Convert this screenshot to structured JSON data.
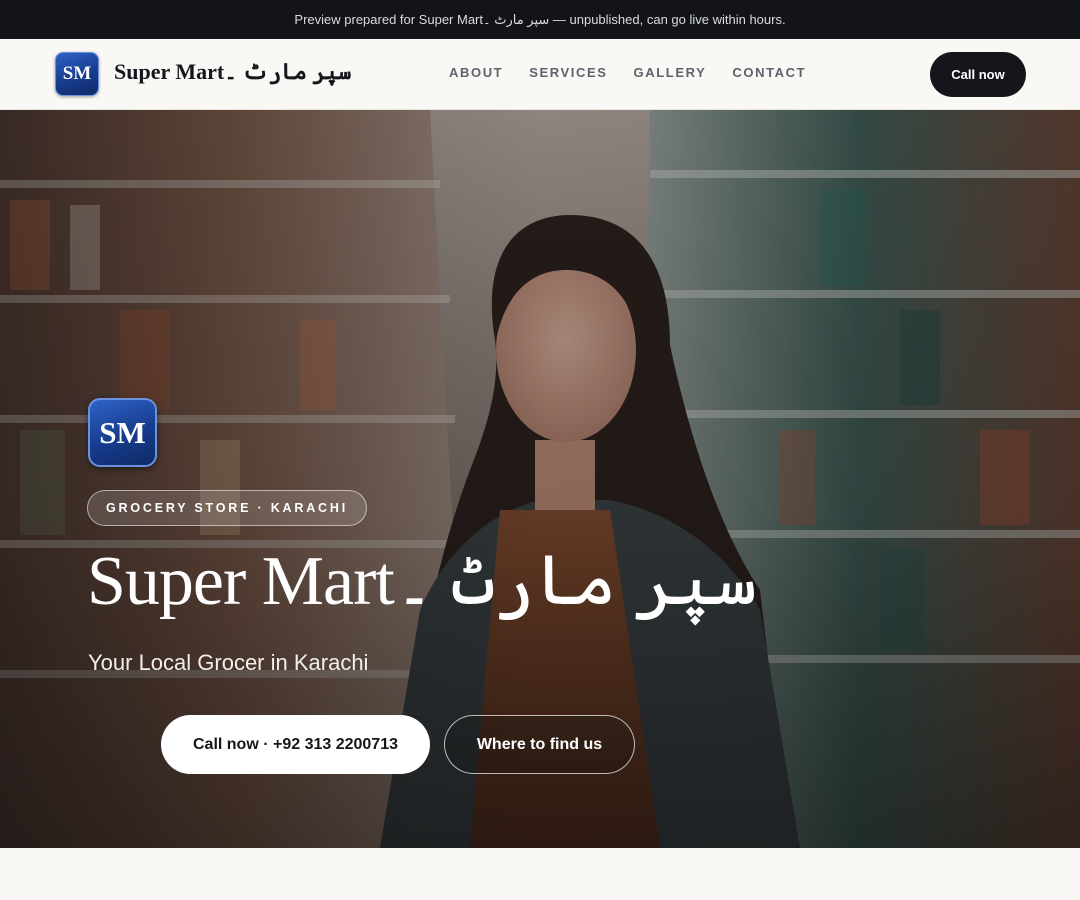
{
  "preview_banner": {
    "text": "Preview prepared for Super Martسپر مارٹ ۔ — unpublished, can go live within hours."
  },
  "nav": {
    "logo_initials": "SM",
    "brand": "Super Martسپر مارٹ ۔",
    "links": [
      "ABOUT",
      "SERVICES",
      "GALLERY",
      "CONTACT"
    ],
    "cta_label": "Call now"
  },
  "hero": {
    "logo_initials": "SM",
    "tag": "GROCERY STORE · KARACHI",
    "title": "Super Martسپر مارٹ ۔",
    "subtitle": "Your Local Grocer in Karachi",
    "primary_button": "Call now · +92 313 2200713",
    "secondary_button": "Where to find us",
    "background": "grocery-aisle-photo"
  },
  "colors": {
    "topbar_bg": "#12141a",
    "nav_bg": "#f9f8f5",
    "cta_bg": "#14161c",
    "logo_blue": "#173c8d",
    "text_dark": "#15171c",
    "nav_link": "#5e626b"
  }
}
